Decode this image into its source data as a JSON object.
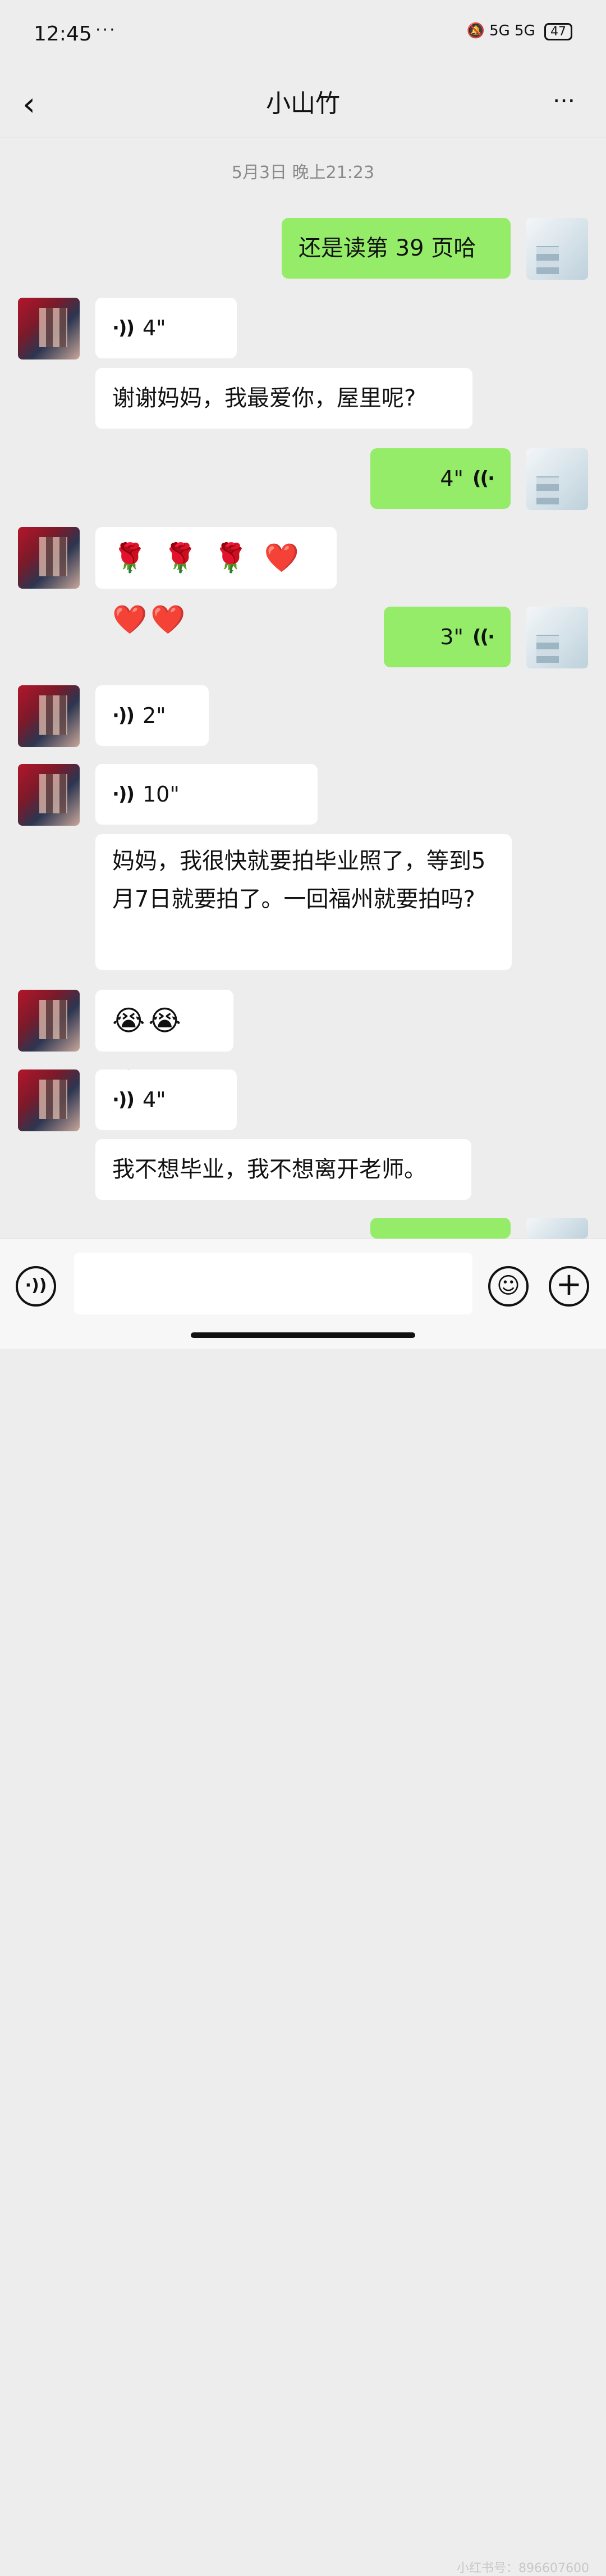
{
  "status_bar": {
    "time": "12:45",
    "dots": "···",
    "network": "5G 5G",
    "battery": "47"
  },
  "header": {
    "back_icon": "‹",
    "title": "小山竹",
    "more_icon": "···"
  },
  "timestamp": "5月3日 晚上21:23",
  "messages": [
    {
      "side": "right",
      "type": "text",
      "text": "还是读第 39 页哈"
    },
    {
      "side": "left",
      "type": "voice",
      "duration": "4\""
    },
    {
      "side": "left",
      "type": "text",
      "text": "谢谢妈妈，我最爱你，屋里呢?"
    },
    {
      "side": "right",
      "type": "voice",
      "duration": "4\""
    },
    {
      "side": "left",
      "type": "emoji",
      "text": "🌹 🌹 🌹 ❤️❤️❤️"
    },
    {
      "side": "right",
      "type": "voice",
      "duration": "3\""
    },
    {
      "side": "left",
      "type": "voice",
      "duration": "2\""
    },
    {
      "side": "left",
      "type": "voice",
      "duration": "10\""
    },
    {
      "side": "left",
      "type": "text",
      "text": "妈妈，我很快就要拍毕业照了，等到5月7日就要拍了。一回福州就要拍吗?"
    },
    {
      "side": "left",
      "type": "emoji",
      "text": "😭😭😭"
    },
    {
      "side": "left",
      "type": "voice",
      "duration": "4\""
    },
    {
      "side": "left",
      "type": "text",
      "text": "我不想毕业，我不想离开老师。"
    }
  ],
  "icons": {
    "voice_left": "·))",
    "voice_right": "((·",
    "voice_input": "·))",
    "emoji": "☺",
    "add": "+"
  },
  "input": {
    "value": "",
    "placeholder": ""
  },
  "watermark": "小红书号：896607600"
}
